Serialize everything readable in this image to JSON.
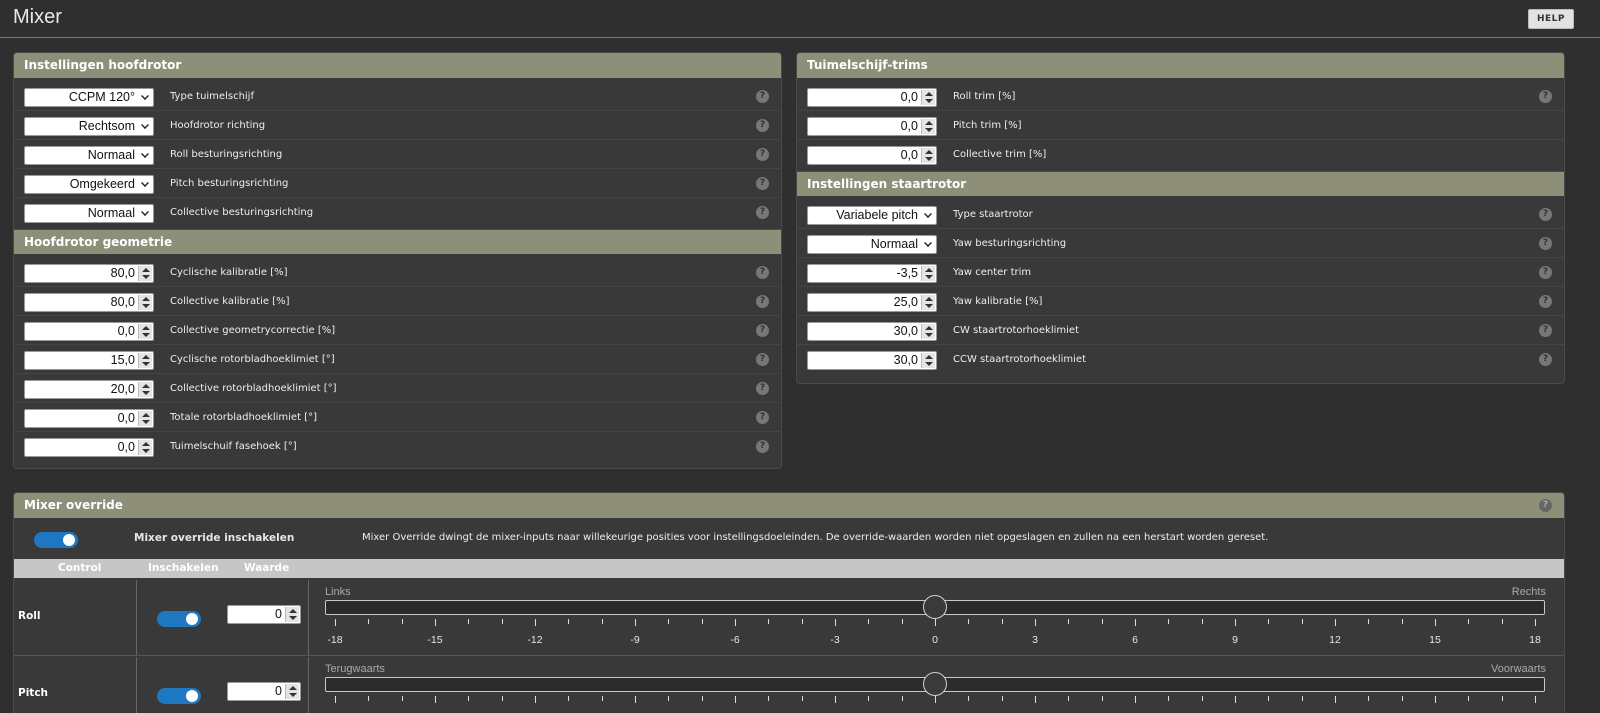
{
  "page": {
    "title": "Mixer",
    "help_label": "HELP"
  },
  "main_rotor": {
    "title": "Instellingen hoofdrotor",
    "rows": [
      {
        "value": "CCPM 120°",
        "label": "Type tuimelschijf"
      },
      {
        "value": "Rechtsom",
        "label": "Hoofdrotor richting"
      },
      {
        "value": "Normaal",
        "label": "Roll besturingsrichting"
      },
      {
        "value": "Omgekeerd",
        "label": "Pitch besturingsrichting"
      },
      {
        "value": "Normaal",
        "label": "Collective besturingsrichting"
      }
    ]
  },
  "geometry": {
    "title": "Hoofdrotor geometrie",
    "rows": [
      {
        "value": "80,0",
        "label": "Cyclische kalibratie [%]"
      },
      {
        "value": "80,0",
        "label": "Collective kalibratie [%]"
      },
      {
        "value": "0,0",
        "label": "Collective geometrycorrectie [%]"
      },
      {
        "value": "15,0",
        "label": "Cyclische rotorbladhoeklimiet [°]"
      },
      {
        "value": "20,0",
        "label": "Collective rotorbladhoeklimiet [°]"
      },
      {
        "value": "0,0",
        "label": "Totale rotorbladhoeklimiet [°]"
      },
      {
        "value": "0,0",
        "label": "Tuimelschuif fasehoek [°]"
      }
    ]
  },
  "trims": {
    "title": "Tuimelschijf-trims",
    "rows": [
      {
        "value": "0,0",
        "label": "Roll trim [%]"
      },
      {
        "value": "0,0",
        "label": "Pitch trim [%]"
      },
      {
        "value": "0,0",
        "label": "Collective trim [%]"
      }
    ]
  },
  "tail_rotor": {
    "title": "Instellingen staartrotor",
    "rows": [
      {
        "value": "Variabele pitch",
        "label": "Type staartrotor"
      },
      {
        "value": "Normaal",
        "label": "Yaw besturingsrichting"
      },
      {
        "value": "-3,5",
        "label": "Yaw center trim"
      },
      {
        "value": "25,0",
        "label": "Yaw kalibratie [%]"
      },
      {
        "value": "30,0",
        "label": "CW staartrotorhoeklimiet"
      },
      {
        "value": "30,0",
        "label": "CCW staartrotorhoeklimiet"
      }
    ]
  },
  "override": {
    "title": "Mixer override",
    "enable_label": "Mixer override inschakelen",
    "enabled": true,
    "description": "Mixer Override dwingt de mixer-inputs naar willekeurige posities voor instellingsdoeleinden. De override-waarden worden niet opgeslagen en zullen na een herstart worden gereset.",
    "columns": [
      "Control",
      "Inschakelen",
      "Waarde"
    ],
    "scale_labels": [
      "-18",
      "-15",
      "-12",
      "-9",
      "-6",
      "-3",
      "0",
      "3",
      "6",
      "9",
      "12",
      "15",
      "18"
    ],
    "rows": [
      {
        "name": "Roll",
        "enabled": true,
        "value": "0",
        "slider_value": 0,
        "left": "Links",
        "right": "Rechts"
      },
      {
        "name": "Pitch",
        "enabled": true,
        "value": "0",
        "slider_value": 0,
        "left": "Terugwaarts",
        "right": "Voorwaarts"
      }
    ]
  },
  "icons": {
    "help": "question-circle-icon",
    "select": "chevron-down-icon",
    "spinner": "spinner-arrows-icon"
  },
  "colors": {
    "accent": "#1d78c1",
    "panel_header": "#8d8f79",
    "background": "#2f2f2f"
  }
}
